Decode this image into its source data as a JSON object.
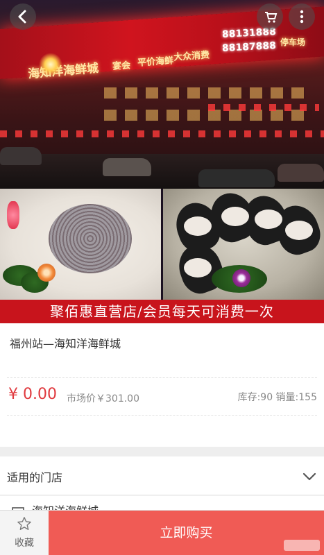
{
  "hero": {
    "sign_name": "海知洋海鲜城",
    "sign_items": [
      "宴会",
      "平价海鲜",
      "大众消费"
    ],
    "sign_phones": [
      "88131888",
      "88187888"
    ],
    "sign_parking": "停车场",
    "banner": "聚佰惠直营店/会员每天可消费一次"
  },
  "nav": {
    "back_icon": "back-arrow-icon",
    "cart_icon": "cart-icon",
    "more_icon": "more-vertical-icon"
  },
  "product": {
    "title": "福州站—海知洋海鲜城",
    "price": "¥ 0.00",
    "market_price": "市场价￥301.00",
    "stock": "库存:90 销量:155"
  },
  "stores": {
    "label": "适用的门店",
    "first_store": "海知洋海鲜城"
  },
  "bottom": {
    "favorite_label": "收藏",
    "buy_label": "立即购买"
  },
  "colors": {
    "accent": "#e0393e",
    "buy_button": "#f05b55",
    "banner": "#c8141c"
  }
}
